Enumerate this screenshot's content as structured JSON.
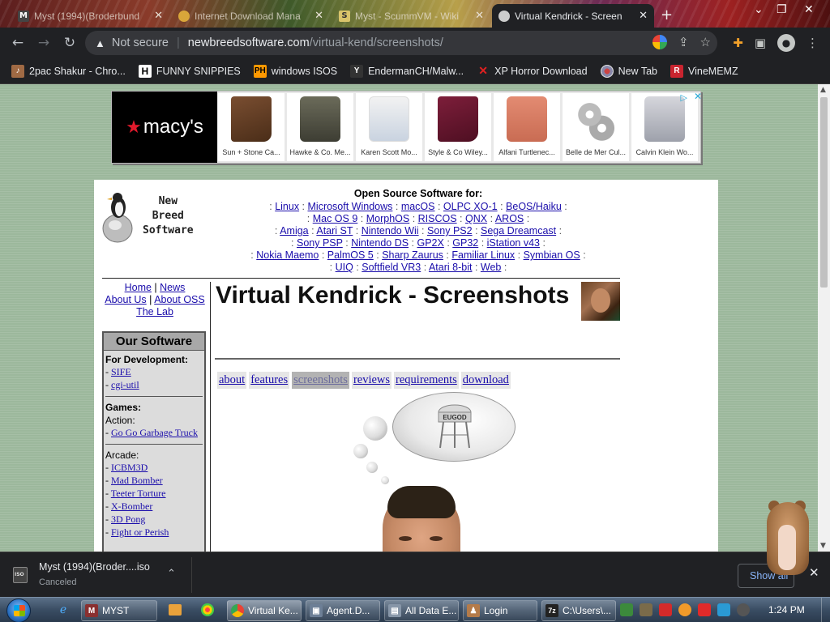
{
  "browser": {
    "tabs": [
      {
        "title": "Myst (1994)(Broderbund",
        "icon": "m-icon",
        "active": false
      },
      {
        "title": "Internet Download Mana",
        "icon": "download-manager-icon",
        "active": false
      },
      {
        "title": "Myst - ScummVM - Wiki",
        "icon": "scummvm-icon",
        "active": false
      },
      {
        "title": "Virtual Kendrick - Screen",
        "icon": "new-breed-icon",
        "active": true
      }
    ],
    "new_tab_symbol": "+",
    "address": {
      "security_label": "Not secure",
      "host": "newbreedsoftware.com",
      "path": "/virtual-kend/screenshots/"
    },
    "bookmarks": [
      {
        "label": "2pac Shakur - Chro...",
        "icon": "2pac-icon"
      },
      {
        "label": "FUNNY SNIPPIES",
        "icon": "h-icon"
      },
      {
        "label": "windows ISOS",
        "icon": "ph-icon"
      },
      {
        "label": "EndermanCH/Malw...",
        "icon": "youtube-icon"
      },
      {
        "label": "XP Horror Download",
        "icon": "x-icon"
      },
      {
        "label": "New Tab",
        "icon": "globe-icon"
      },
      {
        "label": "VineMEMZ",
        "icon": "r-icon"
      }
    ]
  },
  "ad": {
    "brand": "macy's",
    "items": [
      {
        "caption": "Sun + Stone Ca..."
      },
      {
        "caption": "Hawke & Co. Me..."
      },
      {
        "caption": "Karen Scott Mo..."
      },
      {
        "caption": "Style & Co Wiley..."
      },
      {
        "caption": "Alfani Turtlenec..."
      },
      {
        "caption": "Belle de Mer Cul..."
      },
      {
        "caption": "Calvin Klein Wo..."
      }
    ]
  },
  "site": {
    "logo_lines": [
      "New",
      "Breed",
      "Software"
    ],
    "oss_title": "Open Source Software for:",
    "platforms": [
      [
        "Linux",
        "Microsoft Windows",
        "macOS",
        "OLPC XO-1",
        "BeOS/Haiku"
      ],
      [
        "Mac OS 9",
        "MorphOS",
        "RISCOS",
        "QNX",
        "AROS"
      ],
      [
        "Amiga",
        "Atari ST",
        "Nintendo Wii",
        "Sony PS2",
        "Sega Dreamcast"
      ],
      [
        "Sony PSP",
        "Nintendo DS",
        "GP2X",
        "GP32",
        "iStation v43"
      ],
      [
        "Nokia Maemo",
        "PalmOS 5",
        "Sharp Zaurus",
        "Familiar Linux",
        "Symbian OS"
      ],
      [
        "UIQ",
        "Softfield VR3",
        "Atari 8-bit",
        "Web"
      ]
    ],
    "nav": {
      "home": "Home",
      "news": "News",
      "about_us": "About Us",
      "about_oss": "About OSS",
      "lab": "The Lab"
    },
    "sidebar": {
      "title": "Our Software",
      "dev_heading": "For Development:",
      "dev_items": [
        "SIFE",
        "cgi-util"
      ],
      "games_heading": "Games:",
      "action_heading": "Action:",
      "action_items": [
        "Go Go Garbage Truck"
      ],
      "arcade_heading": "Arcade:",
      "arcade_items": [
        "ICBM3D",
        "Mad Bomber",
        "Teeter Torture",
        "X-Bomber",
        "3D Pong",
        "Fight or Perish"
      ]
    },
    "page_title": "Virtual Kendrick - Screenshots",
    "subnav": [
      "about",
      "features",
      "screenshots",
      "reviews",
      "requirements",
      "download"
    ],
    "current_subnav": "screenshots",
    "thought_sign": "EUGOD"
  },
  "downloads": {
    "file_name": "Myst (1994)(Broder....iso",
    "status": "Canceled",
    "file_ext": "ISO",
    "show_all": "Show all"
  },
  "taskbar": {
    "items": [
      {
        "label": "MYST",
        "icon": "myst-icon"
      },
      {
        "label": "Virtual Ke...",
        "icon": "chrome-icon",
        "active": true
      },
      {
        "label": "Agent.D...",
        "icon": "agent-icon"
      },
      {
        "label": "All Data E...",
        "icon": "folder-icon"
      },
      {
        "label": "Login",
        "icon": "login-icon"
      },
      {
        "label": "C:\\Users\\...",
        "icon": "7zip-icon"
      }
    ],
    "clock": "1:24 PM"
  }
}
